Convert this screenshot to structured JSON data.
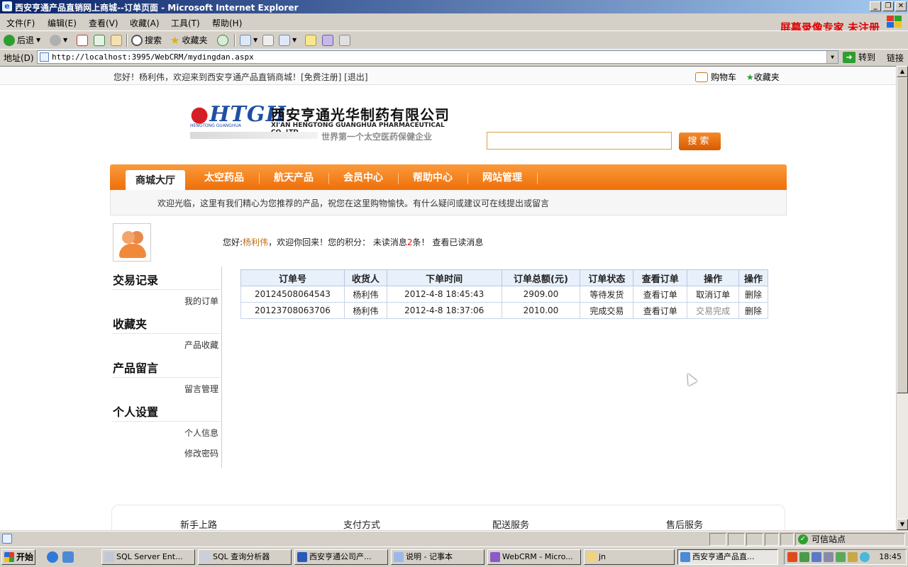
{
  "window": {
    "title": "西安亨通产品直销网上商城--订单页面 - Microsoft Internet Explorer",
    "minimize": "_",
    "restore": "❐",
    "close": "✕"
  },
  "menu": [
    "文件(F)",
    "编辑(E)",
    "查看(V)",
    "收藏(A)",
    "工具(T)",
    "帮助(H)"
  ],
  "watermark": "屏幕录像专家  未注册",
  "toolbar": {
    "back": "后退",
    "search": "搜索",
    "favorites": "收藏夹"
  },
  "address": {
    "label": "地址(D)",
    "url": "http://localhost:3995/WebCRM/mydingdan.aspx",
    "go": "转到",
    "links": "链接"
  },
  "page": {
    "welcome_bar": "您好！杨利伟，欢迎来到西安亨通产品直销商城！[免费注册] [退出]",
    "cart": "购物车",
    "favorites": "收藏夹",
    "logo": {
      "mark": "HTGH",
      "mark_sub": "HENGTONG GUANGHUA",
      "company_cn": "西安亨通光华制药有限公司",
      "company_en": "XI'AN HENGTONG GUANGHUA PHARMACEUTICAL CO.,LTD",
      "slogan": "世界第一个太空医药保健企业"
    },
    "search_button": "搜索",
    "nav": {
      "active": "商城大厅",
      "items": [
        "太空药品",
        "航天产品",
        "会员中心",
        "帮助中心",
        "网站管理"
      ]
    },
    "notice": "欢迎光临，这里有我们精心为您推荐的产品，祝您在这里购物愉快。有什么疑问或建议可在线提出或留言",
    "greeting": {
      "prefix": "您好:",
      "user": "杨利伟",
      "mid": "，欢迎你回来！您的积分：   未读消息",
      "unread": "2",
      "suffix": "条！ 查看已读消息"
    },
    "sidebar": [
      {
        "heading": "交易记录",
        "links": [
          "我的订单"
        ]
      },
      {
        "heading": "收藏夹",
        "links": [
          "产品收藏"
        ]
      },
      {
        "heading": "产品留言",
        "links": [
          "留言管理"
        ]
      },
      {
        "heading": "个人设置",
        "links": [
          "个人信息",
          "修改密码"
        ]
      }
    ],
    "orders": {
      "headers": [
        "订单号",
        "收货人",
        "下单时间",
        "订单总额(元)",
        "订单状态",
        "查看订单",
        "操作",
        "操作"
      ],
      "rows": [
        {
          "id": "20124508064543",
          "receiver": "杨利伟",
          "time": "2012-4-8 18:45:43",
          "total": "2909.00",
          "status": "等待发货",
          "view": "查看订单",
          "action": "取消订单",
          "delete": "删除"
        },
        {
          "id": "20123708063706",
          "receiver": "杨利伟",
          "time": "2012-4-8 18:37:06",
          "total": "2010.00",
          "status": "完成交易",
          "view": "查看订单",
          "action": "交易完成",
          "delete": "删除"
        }
      ]
    },
    "footer": [
      "新手上路",
      "支付方式",
      "配送服务",
      "售后服务"
    ]
  },
  "statusbar": {
    "zone": "可信站点"
  },
  "taskbar": {
    "start": "开始",
    "tasks": [
      "SQL Server Ent...",
      "SQL 查询分析器",
      "西安亨通公司产...",
      "说明 - 记事本",
      "WebCRM - Micro...",
      "jn",
      "西安亨通产品直..."
    ],
    "clock": "18:45"
  },
  "colors": {
    "accent_orange": "#f07a14",
    "titlebar": "#0a246a",
    "watermark_red": "#e00000"
  }
}
